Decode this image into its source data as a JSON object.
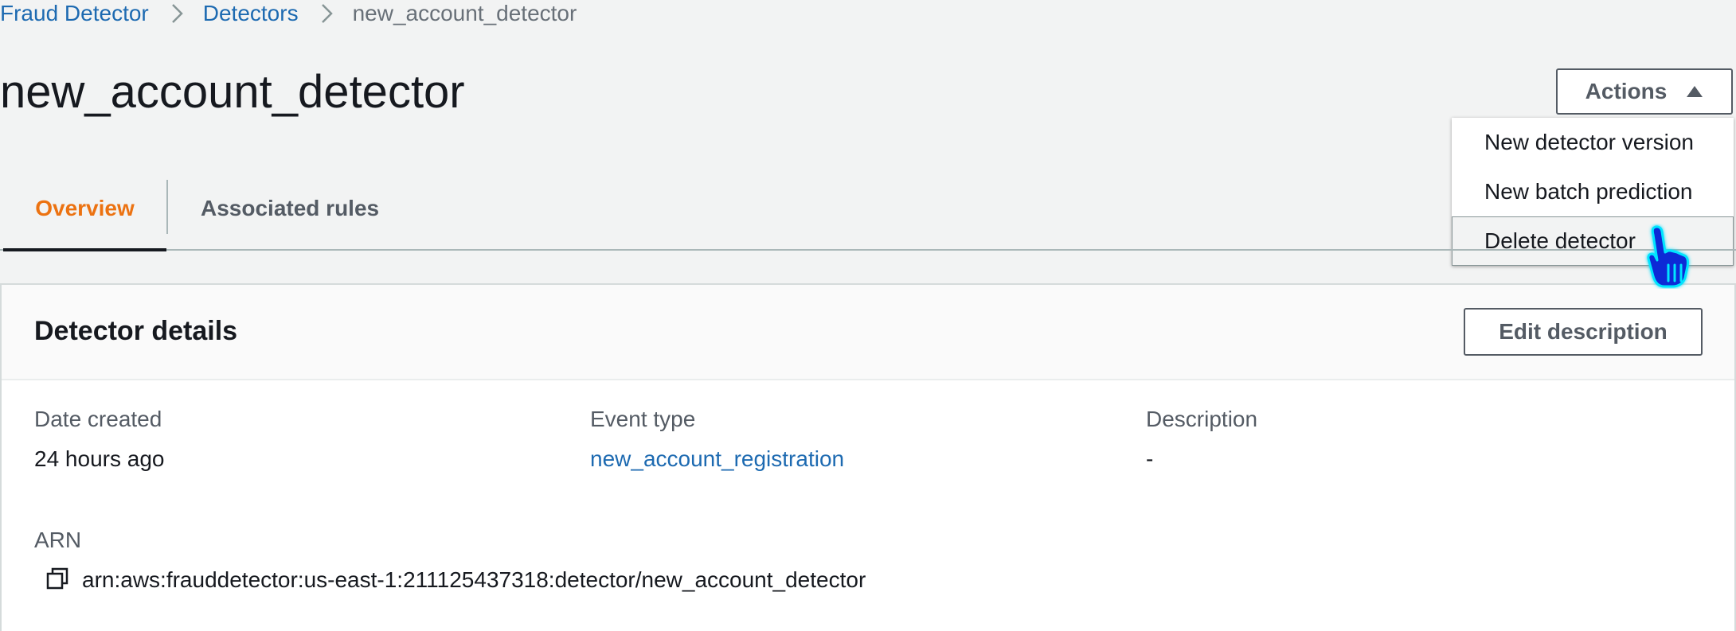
{
  "breadcrumb": {
    "items": [
      "Fraud Detector",
      "Detectors"
    ],
    "current": "new_account_detector"
  },
  "page": {
    "title": "new_account_detector"
  },
  "actions": {
    "label": "Actions",
    "menu": [
      "New detector version",
      "New batch prediction",
      "Delete detector"
    ]
  },
  "tabs": [
    "Overview",
    "Associated rules"
  ],
  "details": {
    "title": "Detector details",
    "edit_label": "Edit description",
    "date_created_label": "Date created",
    "date_created_value": "24 hours ago",
    "event_type_label": "Event type",
    "event_type_value": "new_account_registration",
    "description_label": "Description",
    "description_value": "-",
    "arn_label": "ARN",
    "arn_value": "arn:aws:frauddetector:us-east-1:211125437318:detector/new_account_detector"
  },
  "colors": {
    "link": "#1d6ab1",
    "active_tab": "#ec7211",
    "background": "#f2f3f3"
  }
}
